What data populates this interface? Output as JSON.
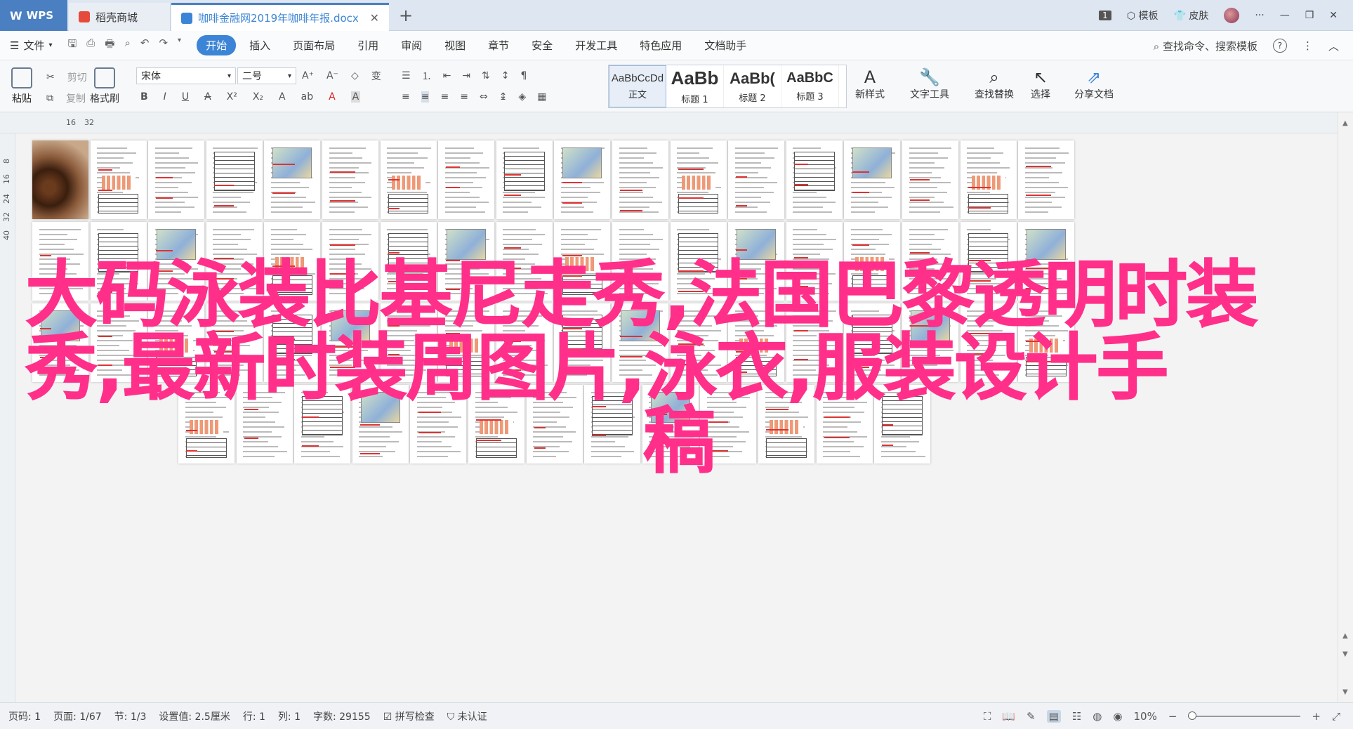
{
  "tabs": {
    "wps": "WPS",
    "store": "稻壳商城",
    "doc": "咖啡金融网2019年咖啡年报.docx",
    "new_tab": "+",
    "close": "✕"
  },
  "titlebar_right": {
    "badge": "1",
    "template": "模板",
    "skin": "皮肤",
    "more": "···"
  },
  "menubar": {
    "file": "文件",
    "items": [
      "开始",
      "插入",
      "页面布局",
      "引用",
      "审阅",
      "视图",
      "章节",
      "安全",
      "开发工具",
      "特色应用",
      "文档助手"
    ],
    "active_index": 0,
    "search": "查找命令、搜索模板",
    "help": "?"
  },
  "ribbon": {
    "paste": "粘贴",
    "cut": "剪切",
    "copy": "复制",
    "format_painter": "格式刷",
    "font_name": "宋体",
    "font_size": "二号",
    "styles": [
      {
        "sample": "AaBbCcDd",
        "name": "正文"
      },
      {
        "sample": "AaBb",
        "name": "标题 1"
      },
      {
        "sample": "AaBb(",
        "name": "标题 2"
      },
      {
        "sample": "AaBbC",
        "name": "标题 3"
      }
    ],
    "new_style": "新样式",
    "text_tools": "文字工具",
    "find_replace": "查找替换",
    "select": "选择",
    "share_doc": "分享文档"
  },
  "ruler": {
    "marks": [
      "16",
      "32"
    ],
    "vmarks": [
      "8",
      "16",
      "24",
      "32",
      "40"
    ]
  },
  "overlay_title": {
    "line1": "大码泳装比基尼走秀,法国巴黎透明时装",
    "line2": "秀,最新时装周图片,泳衣,服装设计手",
    "line3": "稿"
  },
  "statusbar": {
    "page_num": "页码: 1",
    "page": "页面: 1/67",
    "section": "节: 1/3",
    "setting": "设置值: 2.5厘米",
    "row": "行: 1",
    "col": "列: 1",
    "words": "字数: 29155",
    "spell": "拼写检查",
    "auth": "未认证",
    "zoom": "10%",
    "zoom_minus": "−",
    "zoom_plus": "+"
  },
  "colors": {
    "accent": "#3c85d6",
    "overlay": "#ff2f8a",
    "wps_tab": "#4a7fc1"
  }
}
